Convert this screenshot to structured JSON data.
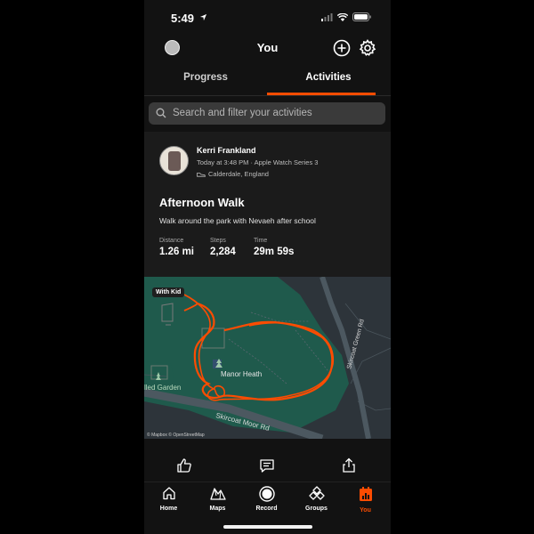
{
  "status": {
    "time": "5:49"
  },
  "header": {
    "title": "You"
  },
  "tabs": [
    {
      "label": "Progress",
      "active": false
    },
    {
      "label": "Activities",
      "active": true
    }
  ],
  "search": {
    "placeholder": "Search and filter your activities"
  },
  "activity": {
    "athlete": "Kerri Frankland",
    "meta": "Today at 3:48 PM · Apple Watch Series 3",
    "location": "Calderdale, England",
    "title": "Afternoon Walk",
    "description": "Walk around the park with Nevaeh after school",
    "stats": [
      {
        "label": "Distance",
        "value": "1.26 mi"
      },
      {
        "label": "Steps",
        "value": "2,284"
      },
      {
        "label": "Time",
        "value": "29m 59s"
      }
    ],
    "map": {
      "badge": "With Kid",
      "park_label": "Manor Heath",
      "garden_label": "lled Garden",
      "road_1": "Skircoat Moor Rd",
      "road_2": "Skircoat Green Rd",
      "credit": "© Mapbox © OpenStreetMap"
    }
  },
  "nav": [
    {
      "label": "Home",
      "icon": "home-icon",
      "active": false
    },
    {
      "label": "Maps",
      "icon": "maps-icon",
      "active": false
    },
    {
      "label": "Record",
      "icon": "record-icon",
      "active": false
    },
    {
      "label": "Groups",
      "icon": "groups-icon",
      "active": false
    },
    {
      "label": "You",
      "icon": "you-icon",
      "active": true
    }
  ],
  "colors": {
    "accent": "#fc4c02",
    "background": "#121212",
    "card": "#1b1b1b",
    "map_green": "#1f5a4c"
  }
}
